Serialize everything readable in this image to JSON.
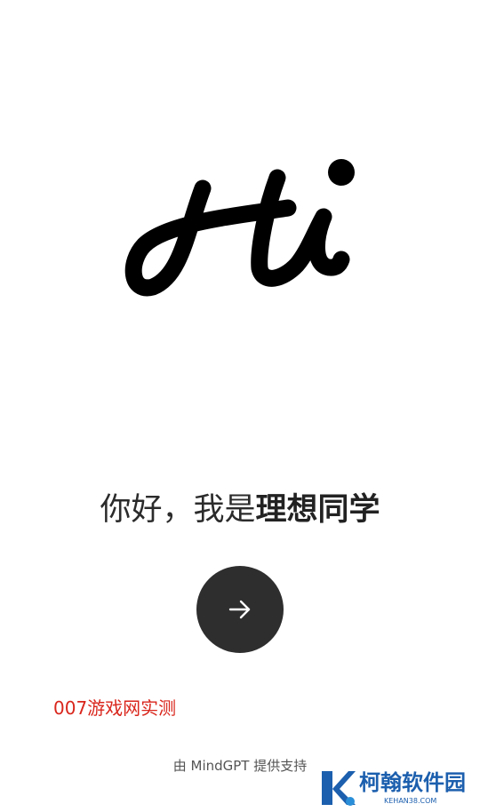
{
  "logo": {
    "text": "Hi"
  },
  "greeting": {
    "regular": "你好，我是",
    "bold": "理想同学"
  },
  "start_button": {
    "icon": "arrow-right-icon"
  },
  "watermark": {
    "label": "007游戏网实测"
  },
  "footer": {
    "text": "由 MindGPT 提供支持"
  },
  "brand": {
    "name": "柯翰软件园",
    "url": "KEHAN38.COM",
    "color": "#1c5fae"
  },
  "colors": {
    "background": "#ffffff",
    "button": "#2e2e2e",
    "watermark": "#d9261c"
  }
}
